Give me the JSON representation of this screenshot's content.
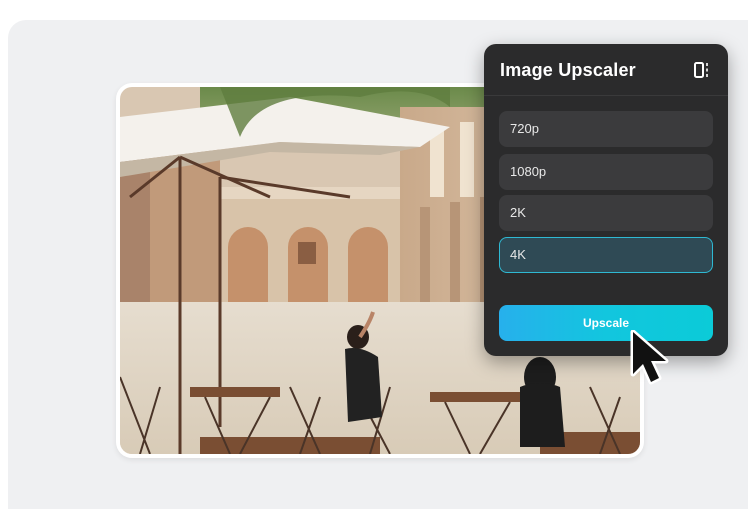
{
  "panel": {
    "title": "Image Upscaler",
    "header_icon": "compare-split-icon",
    "options": [
      {
        "label": "720p",
        "selected": false
      },
      {
        "label": "1080p",
        "selected": false
      },
      {
        "label": "2K",
        "selected": false
      },
      {
        "label": "4K",
        "selected": true
      }
    ],
    "action_label": "Upscale"
  },
  "colors": {
    "panel_bg": "#2b2b2c",
    "option_bg": "#3b3b3d",
    "selected_border": "#2fb9d3",
    "button_gradient_start": "#27b0ec",
    "button_gradient_end": "#0bcbd8",
    "canvas_bg": "#eff0f2"
  },
  "photo": {
    "subject": "cafe-courtyard-photo"
  }
}
